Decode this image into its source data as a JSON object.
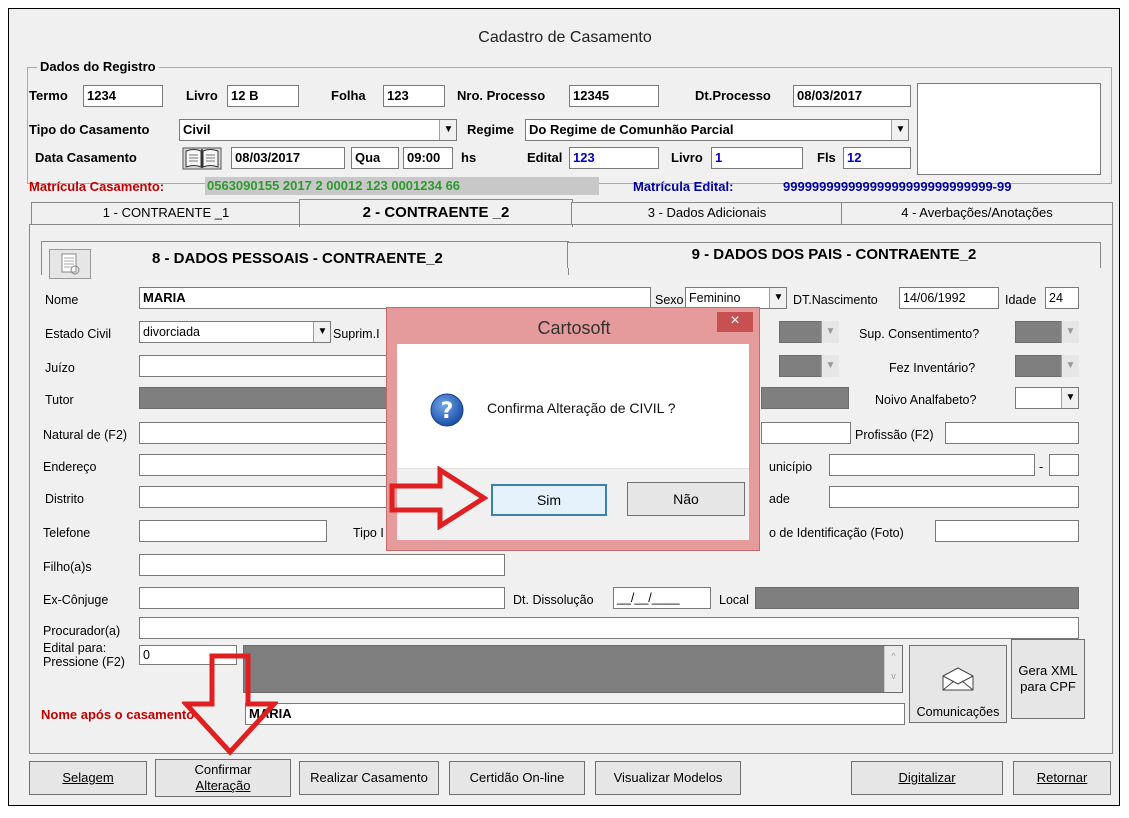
{
  "window": {
    "title": "Cadastro de Casamento"
  },
  "registro": {
    "group_label": "Dados do Registro",
    "termo_label": "Termo",
    "termo_value": "1234",
    "livro_label": "Livro",
    "livro_value": "12  B",
    "folha_label": "Folha",
    "folha_value": "123",
    "nro_processo_label": "Nro. Processo",
    "nro_processo_value": "12345",
    "dt_processo_label": "Dt.Processo",
    "dt_processo_value": "08/03/2017",
    "tipo_casamento_label": "Tipo do Casamento",
    "tipo_casamento_value": "Civil",
    "regime_label": "Regime",
    "regime_value": "Do Regime de Comunhão Parcial",
    "data_casamento_label": "Data Casamento",
    "data_casamento_value": "08/03/2017",
    "dia_semana": "Qua",
    "hora_value": "09:00",
    "hs_label": "hs",
    "edital_label": "Edital",
    "edital_value": "123",
    "livro2_label": "Livro",
    "livro2_value": "1",
    "fls_label": "Fls",
    "fls_value": "12"
  },
  "matricula": {
    "casamento_label": "Matrícula Casamento:",
    "casamento_value": "0563090155 2017 2 00012 123 0001234 66",
    "edital_label": "Matrícula Edital:",
    "edital_value": "99999999999999999999999999999-99"
  },
  "tabs": [
    {
      "label": "1 - CONTRAENTE _1"
    },
    {
      "label": "2 - CONTRAENTE _2"
    },
    {
      "label": "3 - Dados Adicionais"
    },
    {
      "label": "4 - Averbações/Anotações"
    }
  ],
  "subtabs": [
    {
      "label": "8 - DADOS PESSOAIS - CONTRAENTE_2"
    },
    {
      "label": "9 - DADOS DOS PAIS - CONTRAENTE_2"
    }
  ],
  "form": {
    "nome_label": "Nome",
    "nome_value": "MARIA",
    "sexo_label": "Sexo",
    "sexo_value": "Feminino",
    "dt_nasc_label": "DT.Nascimento",
    "dt_nasc_value": "14/06/1992",
    "idade_label": "Idade",
    "idade_value": "24",
    "estado_civil_label": "Estado Civil",
    "estado_civil_value": "divorciada",
    "suprim_label": "Suprim.I",
    "sup_consentimento_label": "Sup. Consentimento?",
    "juizo_label": "Juízo",
    "fez_inventario_label": "Fez Inventário?",
    "tutor_label": "Tutor",
    "noivo_analfabeto_label": "Noivo Analfabeto?",
    "natural_label": "Natural de (F2)",
    "profissao_label": "Profissão (F2)",
    "endereco_label": "Endereço",
    "municipio_label": "unicípio",
    "uf_sep": "-",
    "distrito_label": "Distrito",
    "bairro_partial_label": "ade",
    "telefone_label": "Telefone",
    "tipo_partial_label": "Tipo I",
    "identificacao_label": "o de Identificação (Foto)",
    "filhos_label": "Filho(a)s",
    "ex_conjuge_label": "Ex-Cônjuge",
    "dt_dissolucao_label": "Dt. Dissolução",
    "dt_dissolucao_value": "__/__/____",
    "local_label": "Local",
    "procurador_label": "Procurador(a)",
    "edital_para_label_1": "Edital para:",
    "edital_para_label_2": "Pressione (F2)",
    "edital_para_value": "0",
    "nome_apos_label": "Nome após o casamento",
    "nome_apos_value": "MARIA",
    "comunicacoes_label": "Comunicações",
    "gera_xml_label_1": "Gera XML",
    "gera_xml_label_2": "para CPF"
  },
  "bottom_buttons": {
    "selagem": "Selagem",
    "confirmar_1": "Confirmar",
    "confirmar_2": "Alteração",
    "realizar": "Realizar Casamento",
    "certidao": "Certidão On-line",
    "visualizar": "Visualizar Modelos",
    "digitalizar": "Digitalizar",
    "retornar": "Retornar"
  },
  "dialog": {
    "title": "Cartosoft",
    "close": "×",
    "message": "Confirma Alteração de CIVIL ?",
    "yes": "Sim",
    "no": "Não",
    "icon": "question-icon"
  },
  "colors": {
    "matricula_casamento": "#2e9a2e",
    "matricula_edital": "#0000a0",
    "nome_apos_label": "#c00000",
    "annotation_arrow": "#e02020",
    "dialog_frame": "#e59b9b"
  }
}
